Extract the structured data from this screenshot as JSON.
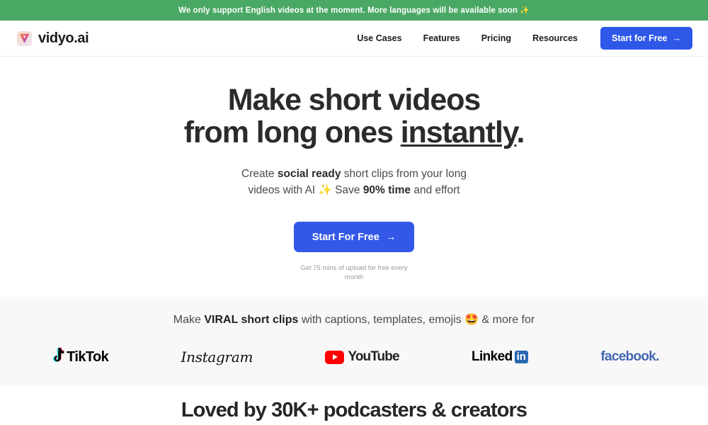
{
  "announcement": {
    "text": "We only support English videos at the moment. More languages will be available soon",
    "sparkle": "✨",
    "background_color": "#4aa865"
  },
  "header": {
    "brand_name": "vidyo.ai",
    "logo_icon": "vidyo-triangle-logo",
    "nav": [
      {
        "label": "Use Cases"
      },
      {
        "label": "Features"
      },
      {
        "label": "Pricing"
      },
      {
        "label": "Resources"
      }
    ],
    "cta_label": "Start for Free",
    "cta_arrow": "→",
    "cta_color": "#2f58e8"
  },
  "hero": {
    "title_line1": "Make short videos",
    "title_line2_prefix": "from long ones ",
    "title_line2_underlined": "instantly",
    "title_line2_suffix": ".",
    "sub_line1_prefix": "Create ",
    "sub_line1_bold": "social ready",
    "sub_line1_suffix": " short clips from your long",
    "sub_line2_prefix": "videos with AI ",
    "sub_line2_sparkle": "✨",
    "sub_line2_mid": " Save ",
    "sub_line2_bold": "90% time",
    "sub_line2_suffix": " and effort",
    "cta_label": "Start For Free",
    "cta_arrow": "→",
    "cta_color": "#3358e8",
    "note": "Get 75 mins of upload for free every month"
  },
  "social_proof": {
    "headline_prefix": "Make ",
    "headline_bold": "VIRAL short clips",
    "headline_mid": " with captions, templates, emojis ",
    "headline_emoji": "🤩",
    "headline_suffix": " & more for",
    "background_color": "#f8f8f8",
    "platforms": [
      {
        "name": "TikTok",
        "icon": "tiktok-note-icon"
      },
      {
        "name": "Instagram",
        "icon": "instagram-wordmark"
      },
      {
        "name": "YouTube",
        "icon": "youtube-play-icon"
      },
      {
        "name": "Linked",
        "badge": "in",
        "icon": "linkedin-icon"
      },
      {
        "name": "facebook",
        "dot": ".",
        "icon": "facebook-wordmark"
      }
    ]
  },
  "loved_section": {
    "title": "Loved by 30K+ podcasters & creators"
  }
}
